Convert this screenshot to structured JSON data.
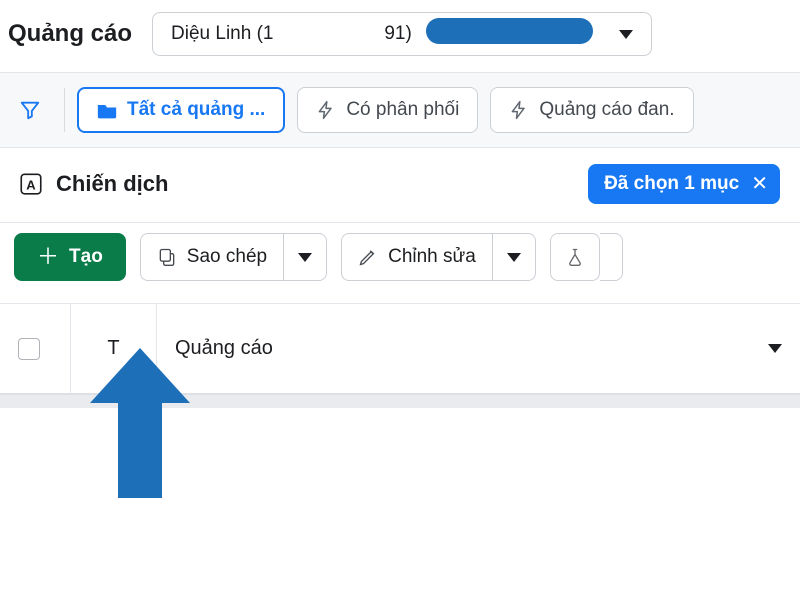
{
  "header": {
    "title": "Quảng cáo",
    "account_name": "Diệu Linh (1",
    "account_suffix": "91)"
  },
  "filters": {
    "all_ads": "Tất cả quảng ...",
    "has_delivery": "Có phân phối",
    "running_ads": "Quảng cáo đan."
  },
  "table": {
    "title": "Chiến dịch",
    "selection_badge": "Đã chọn 1 mục"
  },
  "toolbar": {
    "create": "Tạo",
    "copy": "Sao chép",
    "edit": "Chỉnh sửa"
  },
  "columns": {
    "t_label": "T",
    "ad_label": "Quảng cáo"
  }
}
